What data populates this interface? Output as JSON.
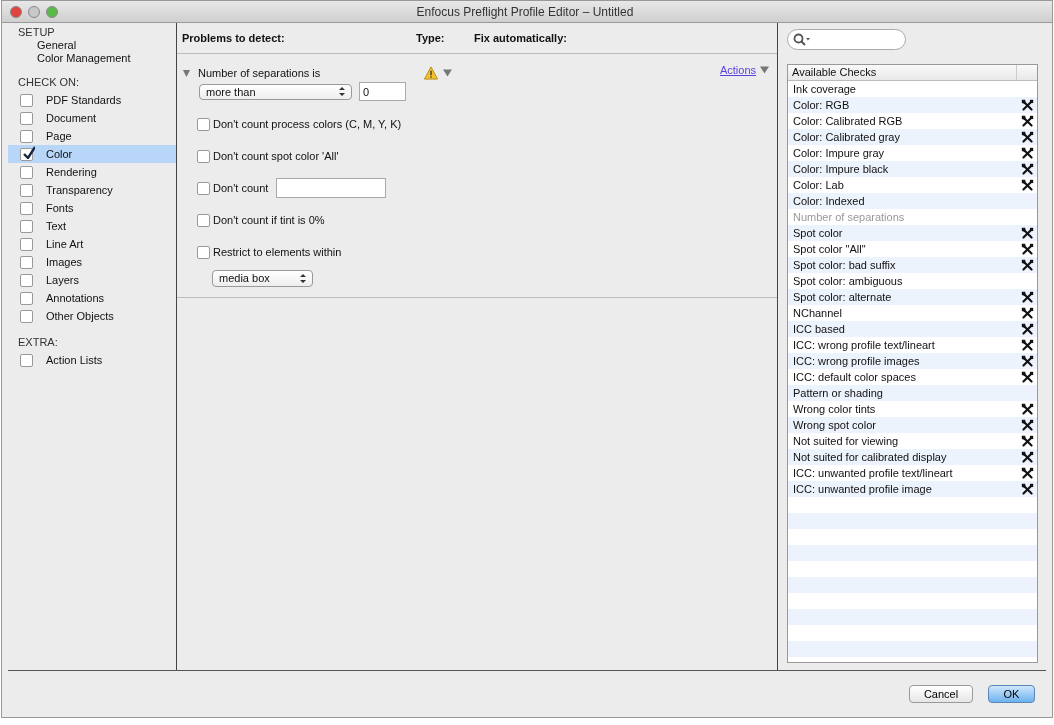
{
  "window": {
    "title": "Enfocus Preflight Profile Editor – Untitled"
  },
  "sidebar": {
    "setup_heading": "SETUP",
    "setup_items": [
      {
        "label": "General"
      },
      {
        "label": "Color Management"
      }
    ],
    "check_heading": "CHECK ON:",
    "check_items": [
      {
        "label": "PDF Standards",
        "checked": false,
        "selected": false
      },
      {
        "label": "Document",
        "checked": false,
        "selected": false
      },
      {
        "label": "Page",
        "checked": false,
        "selected": false
      },
      {
        "label": "Color",
        "checked": true,
        "selected": true
      },
      {
        "label": "Rendering",
        "checked": false,
        "selected": false
      },
      {
        "label": "Transparency",
        "checked": false,
        "selected": false
      },
      {
        "label": "Fonts",
        "checked": false,
        "selected": false
      },
      {
        "label": "Text",
        "checked": false,
        "selected": false
      },
      {
        "label": "Line Art",
        "checked": false,
        "selected": false
      },
      {
        "label": "Images",
        "checked": false,
        "selected": false
      },
      {
        "label": "Layers",
        "checked": false,
        "selected": false
      },
      {
        "label": "Annotations",
        "checked": false,
        "selected": false
      },
      {
        "label": "Other Objects",
        "checked": false,
        "selected": false
      }
    ],
    "extra_heading": "EXTRA:",
    "extra_items": [
      {
        "label": "Action Lists",
        "checked": false,
        "selected": false
      }
    ]
  },
  "problems": {
    "columns": [
      "Problems to detect:",
      "Type:",
      "Fix automatically:"
    ],
    "check": {
      "title": "Number of separations is",
      "expanded": true,
      "actions_link": "Actions",
      "comparison": "more than",
      "count_value": "0",
      "options": [
        {
          "kind": "checkbox",
          "label": "Don't count process colors (C, M, Y, K)",
          "checked": false
        },
        {
          "kind": "checkbox",
          "label": "Don't count spot color 'All'",
          "checked": false
        },
        {
          "kind": "checkbox_field",
          "label": "Don't count",
          "checked": false
        },
        {
          "kind": "checkbox",
          "label": "Don't count if tint is 0%",
          "checked": false
        },
        {
          "kind": "checkbox",
          "label": "Restrict to elements within",
          "checked": false
        },
        {
          "kind": "dropdown",
          "value": "media box"
        }
      ]
    }
  },
  "available": {
    "column": "Available Checks",
    "items": [
      {
        "label": "Ink coverage",
        "fixable": false,
        "disabled": false
      },
      {
        "label": "Color: RGB",
        "fixable": true,
        "disabled": false
      },
      {
        "label": "Color: Calibrated RGB",
        "fixable": true,
        "disabled": false
      },
      {
        "label": "Color: Calibrated gray",
        "fixable": true,
        "disabled": false
      },
      {
        "label": "Color: Impure gray",
        "fixable": true,
        "disabled": false
      },
      {
        "label": "Color: Impure black",
        "fixable": true,
        "disabled": false
      },
      {
        "label": "Color: Lab",
        "fixable": true,
        "disabled": false
      },
      {
        "label": "Color: Indexed",
        "fixable": false,
        "disabled": false
      },
      {
        "label": "Number of separations",
        "fixable": false,
        "disabled": true
      },
      {
        "label": "Spot color",
        "fixable": true,
        "disabled": false
      },
      {
        "label": "Spot color \"All\"",
        "fixable": true,
        "disabled": false
      },
      {
        "label": "Spot color: bad suffix",
        "fixable": true,
        "disabled": false
      },
      {
        "label": "Spot color: ambiguous",
        "fixable": false,
        "disabled": false
      },
      {
        "label": "Spot color: alternate",
        "fixable": true,
        "disabled": false
      },
      {
        "label": "NChannel",
        "fixable": true,
        "disabled": false
      },
      {
        "label": "ICC based",
        "fixable": true,
        "disabled": false
      },
      {
        "label": "ICC: wrong profile text/lineart",
        "fixable": true,
        "disabled": false
      },
      {
        "label": "ICC: wrong profile images",
        "fixable": true,
        "disabled": false
      },
      {
        "label": "ICC: default color spaces",
        "fixable": true,
        "disabled": false
      },
      {
        "label": "Pattern or shading",
        "fixable": false,
        "disabled": false
      },
      {
        "label": "Wrong color tints",
        "fixable": true,
        "disabled": false
      },
      {
        "label": "Wrong spot color",
        "fixable": true,
        "disabled": false
      },
      {
        "label": "Not suited for viewing",
        "fixable": true,
        "disabled": false
      },
      {
        "label": "Not suited for calibrated display",
        "fixable": true,
        "disabled": false
      },
      {
        "label": "ICC: unwanted profile text/lineart",
        "fixable": true,
        "disabled": false
      },
      {
        "label": "ICC: unwanted profile image",
        "fixable": true,
        "disabled": false
      }
    ]
  },
  "buttons": [
    {
      "label": "Cancel",
      "default": false
    },
    {
      "label": "OK",
      "default": true
    }
  ]
}
